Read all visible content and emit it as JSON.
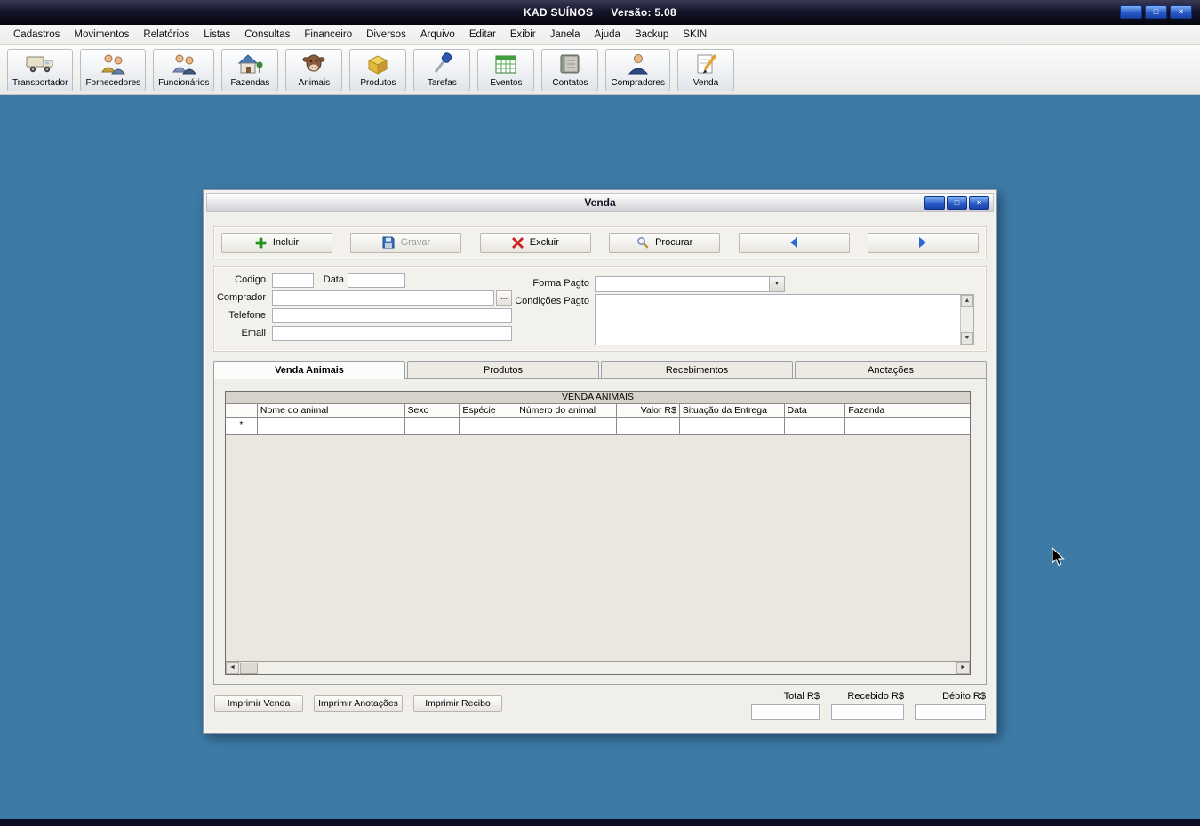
{
  "titlebar": {
    "app_title": "KAD SUÍNOS",
    "version": "Versão: 5.08"
  },
  "window_controls": {
    "minimize": "–",
    "maximize": "□",
    "close": "×"
  },
  "glyphs": {
    "dropdown": "▼",
    "up": "▲",
    "down": "▼",
    "left": "◄",
    "right": "►"
  },
  "menu": {
    "items": [
      "Cadastros",
      "Movimentos",
      "Relatórios",
      "Listas",
      "Consultas",
      "Financeiro",
      "Diversos",
      "Arquivo",
      "Editar",
      "Exibir",
      "Janela",
      "Ajuda",
      "Backup",
      "SKIN"
    ]
  },
  "toolbar": {
    "items": [
      {
        "label": "Transportador",
        "icon": "truck-icon"
      },
      {
        "label": "Fornecedores",
        "icon": "suppliers-people-icon"
      },
      {
        "label": "Funcionários",
        "icon": "employees-people-icon"
      },
      {
        "label": "Fazendas",
        "icon": "farm-house-icon"
      },
      {
        "label": "Animais",
        "icon": "animal-head-icon"
      },
      {
        "label": "Produtos",
        "icon": "box-icon"
      },
      {
        "label": "Tarefas",
        "icon": "screwdriver-icon"
      },
      {
        "label": "Eventos",
        "icon": "calendar-icon"
      },
      {
        "label": "Contatos",
        "icon": "address-book-icon"
      },
      {
        "label": "Compradores",
        "icon": "buyer-person-icon"
      },
      {
        "label": "Venda",
        "icon": "pencil-note-icon"
      }
    ]
  },
  "window": {
    "title": "Venda",
    "actions": [
      {
        "label": "Incluir",
        "icon": "plus-icon",
        "enabled": true
      },
      {
        "label": "Gravar",
        "icon": "save-icon",
        "enabled": false
      },
      {
        "label": "Excluir",
        "icon": "delete-x-icon",
        "enabled": true
      },
      {
        "label": "Procurar",
        "icon": "search-icon",
        "enabled": true
      },
      {
        "label": "",
        "icon": "arrow-left-icon",
        "enabled": true
      },
      {
        "label": "",
        "icon": "arrow-right-icon",
        "enabled": true
      }
    ],
    "form": {
      "labels": {
        "codigo": "Codigo",
        "data": "Data",
        "comprador": "Comprador",
        "telefone": "Telefone",
        "email": "Email",
        "forma_pagto": "Forma Pagto",
        "condicoes_pagto": "Condições Pagto"
      },
      "values": {
        "codigo": "",
        "data": "",
        "comprador": "",
        "telefone": "",
        "email": "",
        "forma_pagto": "",
        "condicoes_pagto": ""
      },
      "browse_label": "..."
    },
    "tabs": [
      {
        "label": "Venda Animais",
        "active": true
      },
      {
        "label": "Produtos",
        "active": false
      },
      {
        "label": "Recebimentos",
        "active": false
      },
      {
        "label": "Anotações",
        "active": false
      }
    ],
    "grid": {
      "title": "VENDA ANIMAIS",
      "columns": [
        "Nome do animal",
        "Sexo",
        "Espécie",
        "Número do animal",
        "Valor R$",
        "Situação da Entrega",
        "Data",
        "Fazenda"
      ],
      "new_row_marker": "*",
      "rows": []
    },
    "print_buttons": [
      "Imprimir Venda",
      "Imprimir Anotações",
      "Imprimir Recibo"
    ],
    "totals": {
      "total_label": "Total R$",
      "total_value": "",
      "recebido_label": "Recebido R$",
      "recebido_value": "",
      "debito_label": "Débito R$",
      "debito_value": ""
    }
  },
  "colors": {
    "mdi_background": "#3d7ba6",
    "app_titlebar": "#10101f",
    "control_button_blue": "#2a5ac8",
    "window_chrome": "#f0efe9",
    "disabled_text": "#9a9a9a",
    "grid_header_band": "#d7d3ca"
  }
}
